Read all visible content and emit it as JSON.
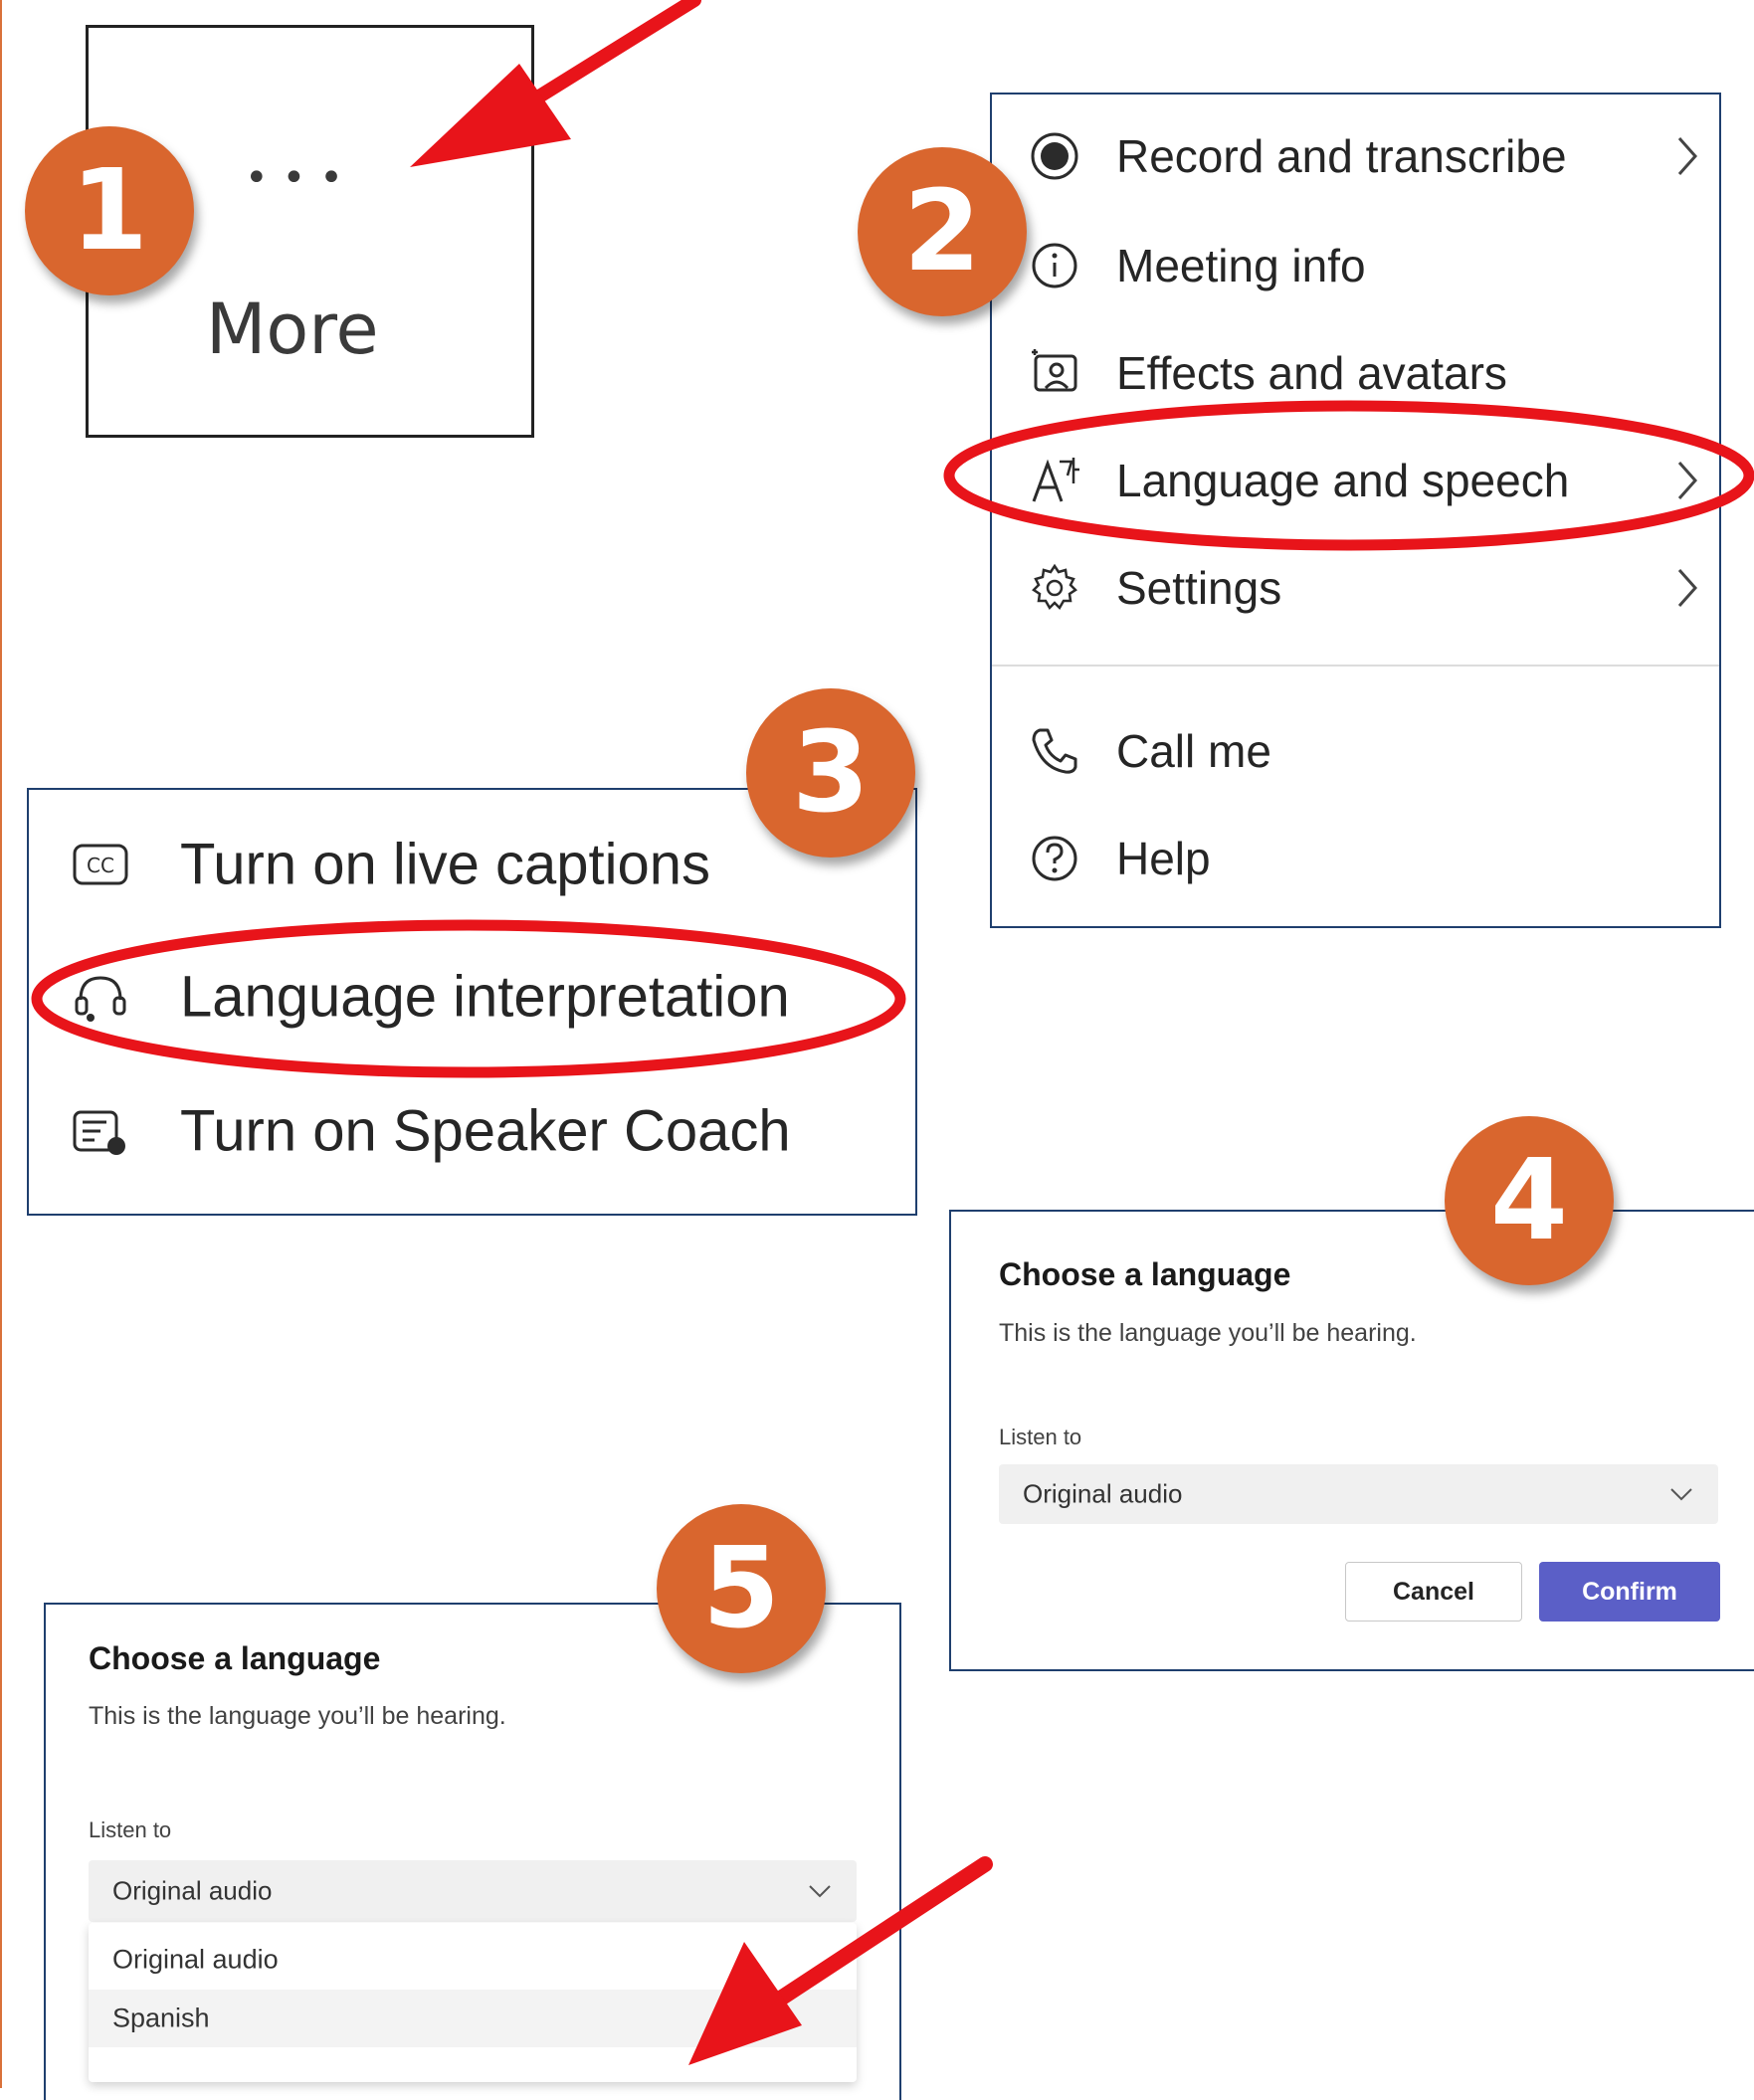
{
  "steps": [
    "1",
    "2",
    "3",
    "4",
    "5"
  ],
  "step1": {
    "dots": "•••",
    "label": "More"
  },
  "menu": {
    "items": [
      {
        "label": "Record and transcribe",
        "icon": "record-icon",
        "chevron": true
      },
      {
        "label": "Meeting info",
        "icon": "info-icon",
        "chevron": false
      },
      {
        "label": "Effects and avatars",
        "icon": "effects-icon",
        "chevron": false
      },
      {
        "label": "Language and speech",
        "icon": "language-icon",
        "chevron": true
      },
      {
        "label": "Settings",
        "icon": "gear-icon",
        "chevron": true
      },
      {
        "label": "Call me",
        "icon": "phone-icon",
        "chevron": false
      },
      {
        "label": "Help",
        "icon": "help-icon",
        "chevron": false
      }
    ]
  },
  "submenu": {
    "items": [
      {
        "label": "Turn on live captions",
        "icon": "cc-icon"
      },
      {
        "label": "Language interpretation",
        "icon": "headset-icon"
      },
      {
        "label": "Turn on Speaker Coach",
        "icon": "speaker-coach-icon"
      }
    ]
  },
  "dialog": {
    "title": "Choose a language",
    "subtitle": "This is the language you’ll be hearing.",
    "listen_label": "Listen to",
    "selected": "Original audio",
    "cancel": "Cancel",
    "confirm": "Confirm",
    "options": [
      "Original audio",
      "Spanish"
    ]
  },
  "colors": {
    "badge": "#d9662e",
    "annotation_red": "#e8141a",
    "panel_border": "#1f3f6e",
    "confirm": "#5b5fc7"
  }
}
